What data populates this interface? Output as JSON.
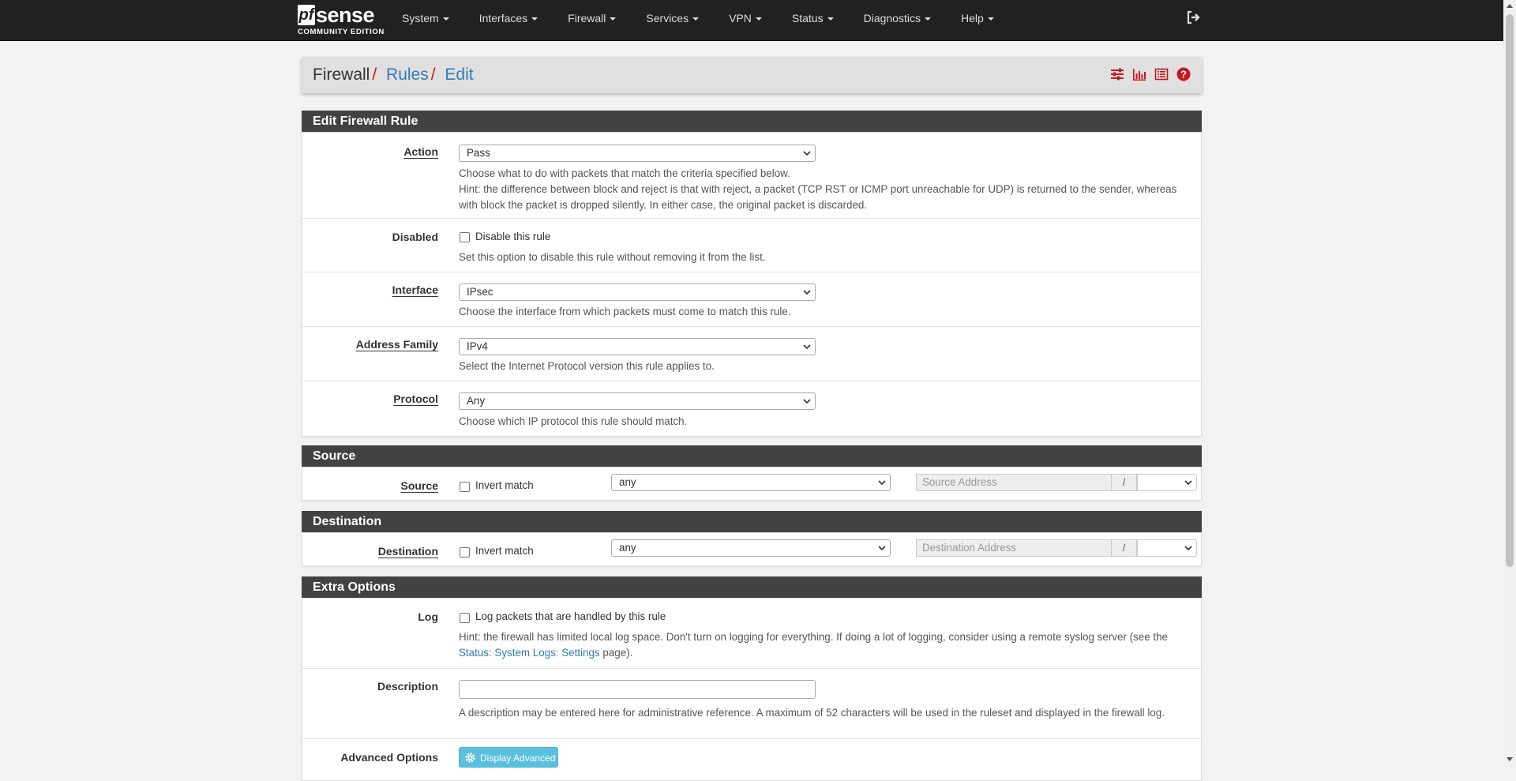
{
  "brand": {
    "logo_pf": "pf",
    "logo_sense": "sense",
    "edition": "COMMUNITY EDITION"
  },
  "nav": {
    "items": [
      "System",
      "Interfaces",
      "Firewall",
      "Services",
      "VPN",
      "Status",
      "Diagnostics",
      "Help"
    ],
    "logout_icon": "sign-out-icon"
  },
  "breadcrumb": {
    "items": [
      "Firewall",
      "Rules",
      "Edit"
    ],
    "separator": "/"
  },
  "panels": {
    "edit": {
      "title": "Edit Firewall Rule",
      "action": {
        "label": "Action",
        "value": "Pass",
        "help1": "Choose what to do with packets that match the criteria specified below.",
        "help2": "Hint: the difference between block and reject is that with reject, a packet (TCP RST or ICMP port unreachable for UDP) is returned to the sender, whereas with block the packet is dropped silently. In either case, the original packet is discarded."
      },
      "disabled": {
        "label": "Disabled",
        "checkbox_label": "Disable this rule",
        "checked": false,
        "help": "Set this option to disable this rule without removing it from the list."
      },
      "interface": {
        "label": "Interface",
        "value": "IPsec",
        "help": "Choose the interface from which packets must come to match this rule."
      },
      "address_family": {
        "label": "Address Family",
        "value": "IPv4",
        "help": "Select the Internet Protocol version this rule applies to."
      },
      "protocol": {
        "label": "Protocol",
        "value": "Any",
        "help": "Choose which IP protocol this rule should match."
      }
    },
    "source": {
      "title": "Source",
      "label": "Source",
      "invert_label": "Invert match",
      "type_value": "any",
      "address_placeholder": "Source Address",
      "slash": "/"
    },
    "destination": {
      "title": "Destination",
      "label": "Destination",
      "invert_label": "Invert match",
      "type_value": "any",
      "address_placeholder": "Destination Address",
      "slash": "/"
    },
    "extra": {
      "title": "Extra Options",
      "log": {
        "label": "Log",
        "checkbox_label": "Log packets that are handled by this rule",
        "help_before": "Hint: the firewall has limited local log space. Don't turn on logging for everything. If doing a lot of logging, consider using a remote syslog server (see the ",
        "help_link": "Status: System Logs: Settings",
        "help_after": " page)."
      },
      "description": {
        "label": "Description",
        "value": "",
        "help": "A description may be entered here for administrative reference. A maximum of 52 characters will be used in the ruleset and displayed in the firewall log."
      },
      "advanced": {
        "label": "Advanced Options",
        "button": "Display Advanced"
      }
    }
  },
  "colors": {
    "navbar": "#212121",
    "panel_heading": "#424242",
    "link": "#337ab7",
    "accent_red": "#c5181c",
    "info_button": "#5bc0de"
  }
}
